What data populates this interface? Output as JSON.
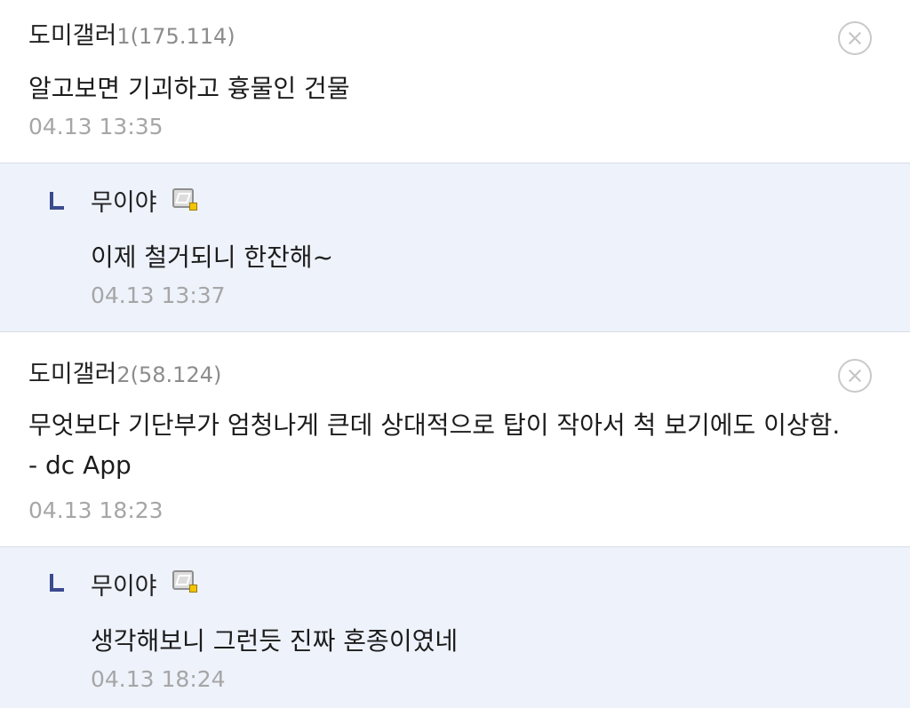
{
  "comments": [
    {
      "nickname": "도미갤러",
      "ip_suffix": "1(175.114)",
      "body": "알고보면 기괴하고 흉물인 건물",
      "timestamp": "04.13 13:35",
      "reply": {
        "nickname": "무이야",
        "body": "이제 철거되니 한잔해~",
        "timestamp": "04.13 13:37"
      }
    },
    {
      "nickname": "도미갤러",
      "ip_suffix": "2(58.124)",
      "body": "무엇보다 기단부가 엄청나게 큰데 상대적으로 탑이 작아서 척 보기에도 이상함.",
      "app_tag": "- dc App",
      "timestamp": "04.13 18:23",
      "reply": {
        "nickname": "무이야",
        "body": "생각해보니 그런듯 진짜 혼종이였네",
        "timestamp": "04.13 18:24"
      }
    }
  ],
  "colors": {
    "reply_background": "#eef2fb",
    "reply_mark": "#3b4a8f",
    "timestamp": "#a6a6a6"
  },
  "icons": {
    "delete": "circle-x-icon",
    "reply": "reply-arrow-icon",
    "gallery": "gallery-fixed-nick-icon"
  }
}
